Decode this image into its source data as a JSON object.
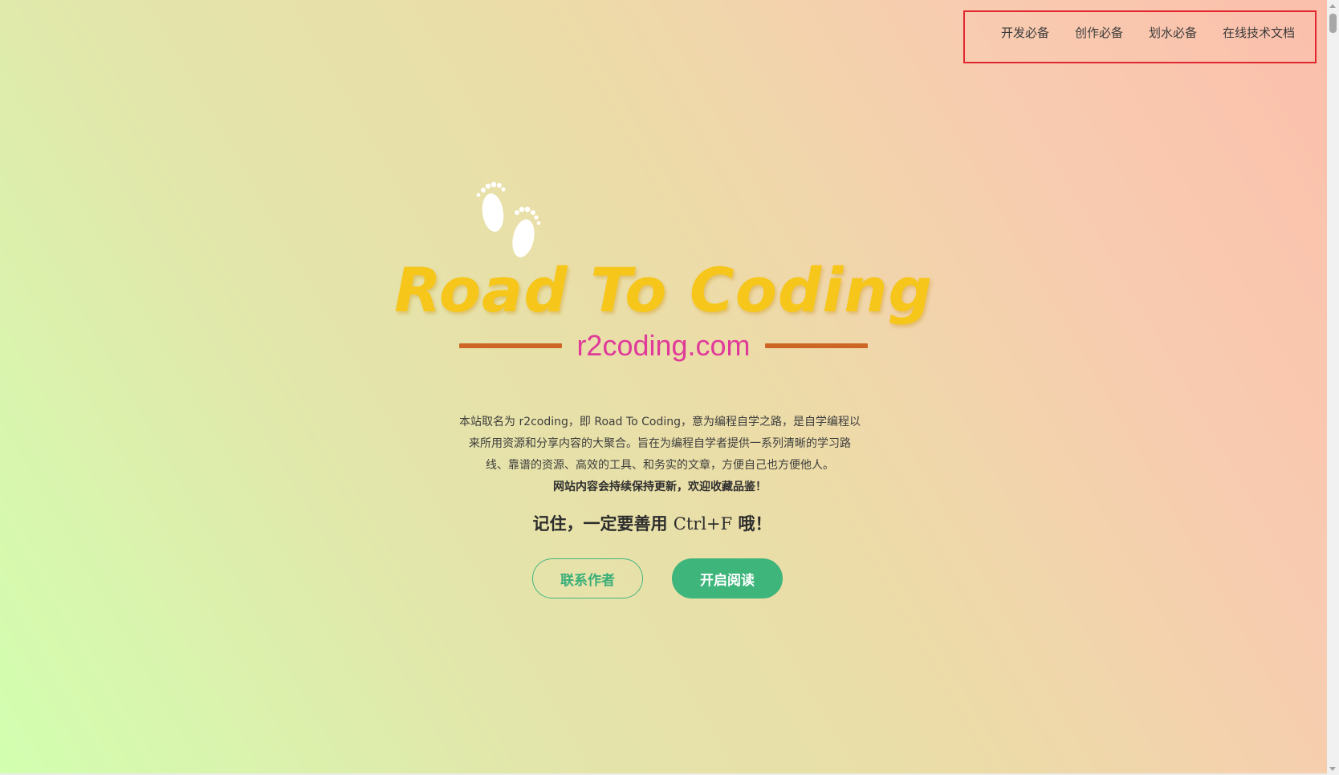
{
  "nav": {
    "items": [
      {
        "label": "开发必备"
      },
      {
        "label": "创作必备"
      },
      {
        "label": "划水必备"
      },
      {
        "label": "在线技术文档"
      }
    ]
  },
  "logo": {
    "brand": "Road To Coding",
    "domain": "r2coding.com",
    "icon": "footprints-icon"
  },
  "intro": {
    "line1": "本站取名为 r2coding，即 Road To Coding，意为编程自学之路，是自学编程以来所用资源和分享内容的大聚合。旨在为编程自学者提供一系列清晰的学习路线、靠谱的资源、高效的工具、和务实的文章，方便自己也方便他人。",
    "bold": "网站内容会持续保持更新，欢迎收藏品鉴！"
  },
  "remember": {
    "prefix": "记住，一定要善用",
    "shortcut": "Ctrl+F",
    "suffix": "哦！"
  },
  "buttons": {
    "contact": "联系作者",
    "read": "开启阅读"
  },
  "colors": {
    "accent": "#3eb57b",
    "brand": "#f6c61a",
    "domain": "#e03a9a",
    "highlight_box": "#e0262f"
  }
}
